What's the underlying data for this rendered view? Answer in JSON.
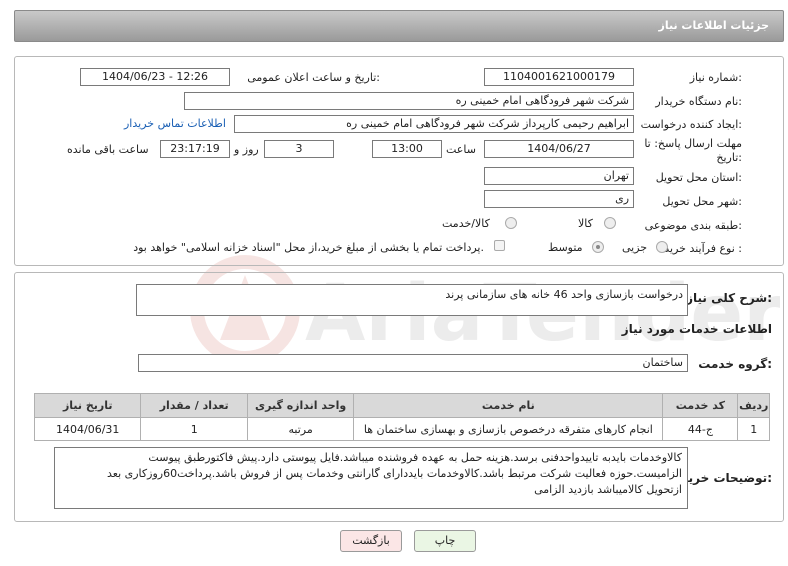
{
  "header": {
    "title": "جزئیات اطلاعات نیاز"
  },
  "fields": {
    "need_number_label": "شماره نیاز:",
    "need_number": "1104001621000179",
    "announce_label": "تاریخ و ساعت اعلان عمومی:",
    "announce_value": "1404/06/23 - 12:26",
    "buyer_org_label": "نام دستگاه خریدار:",
    "buyer_org": "شرکت شهر فرودگاهی امام خمینی  ره",
    "creator_label": "ایجاد کننده درخواست:",
    "creator": "ابراهیم رحیمی کارپرداز شرکت شهر فرودگاهی امام خمینی  ره",
    "contact_link": "اطلاعات تماس خریدار",
    "deadline_label_1": "مهلت ارسال پاسخ: تا",
    "deadline_label_2": "تاریخ:",
    "deadline_date": "1404/06/27",
    "time_label": "ساعت",
    "deadline_time": "13:00",
    "days_value": "3",
    "days_label": "روز و",
    "remaining_time": "23:17:19",
    "remaining_label": "ساعت باقی مانده",
    "province_label": "استان محل تحویل:",
    "province": "تهران",
    "city_label": "شهر محل تحویل:",
    "city": "ری",
    "category_label": "طبقه بندی موضوعی:",
    "category_options": [
      "کالا",
      "کالا/خدمت"
    ],
    "process_label": "نوع فرآیند خرید :",
    "process_options": [
      "جزیی",
      "متوسط"
    ],
    "payment_note": "پرداخت تمام یا بخشی از مبلغ خرید،از محل \"اسناد خزانه اسلامی\" خواهد بود."
  },
  "summary": {
    "label": "شرح کلی نیاز:",
    "value": "درخواست بازسازی واحد 46 خانه های سازمانی پرند"
  },
  "services_section": {
    "title": "اطلاعات خدمات مورد نیاز",
    "group_label": "گروه خدمت:",
    "group_value": "ساختمان"
  },
  "table": {
    "headers": [
      "ردیف",
      "کد خدمت",
      "نام خدمت",
      "واحد اندازه گیری",
      "تعداد / مقدار",
      "تاریخ نیاز"
    ],
    "rows": [
      [
        "1",
        "ج-44",
        "انجام کارهای متفرقه درخصوص بازسازی و بهسازی ساختمان ها",
        "مرتبه",
        "1",
        "1404/06/31"
      ]
    ]
  },
  "buyer_notes": {
    "label": "توضیحات خریدار:",
    "lines": [
      "کالاوخدمات بایدبه تاییدواحدفنی برسد.هزینه حمل به عهده فروشنده میباشد.فایل پیوستی دارد.پیش فاکتورطبق پیوست",
      "الزامیست.حوزه فعالیت شرکت مرتبط باشد.کالاوخدمات بایددارای گارانتی وخدمات پس از فروش باشد.پرداخت60روزکاری بعد",
      "ازتحویل کالامیباشد بازدید الزامی"
    ]
  },
  "buttons": {
    "print": "چاپ",
    "back": "بازگشت"
  },
  "watermark_text": "AriaTender.net",
  "colors": {
    "header_bg": "#a9a9a9",
    "link": "#1a5fb4",
    "print_bg": "#eaf6e4",
    "back_bg": "#fbe6e6"
  }
}
